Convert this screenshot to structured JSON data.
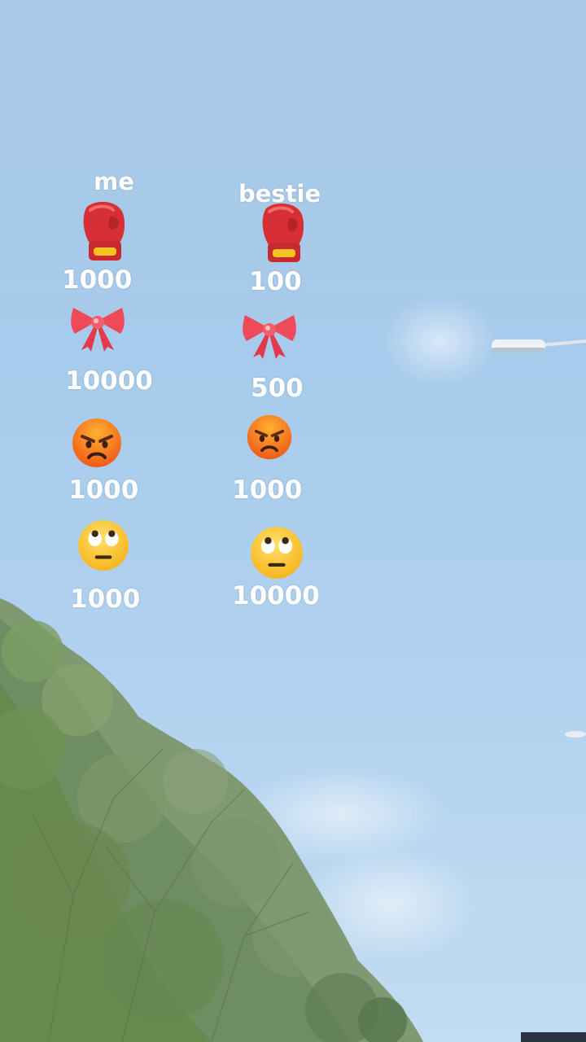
{
  "columns": [
    {
      "header": "me",
      "values": [
        "1000",
        "10000",
        "1000",
        "1000"
      ]
    },
    {
      "header": "bestie",
      "values": [
        "100",
        "500",
        "1000",
        "10000"
      ]
    }
  ],
  "emoji_icons": [
    "boxing-glove-icon",
    "ribbon-bow-icon",
    "angry-face-icon",
    "eye-roll-face-icon"
  ]
}
